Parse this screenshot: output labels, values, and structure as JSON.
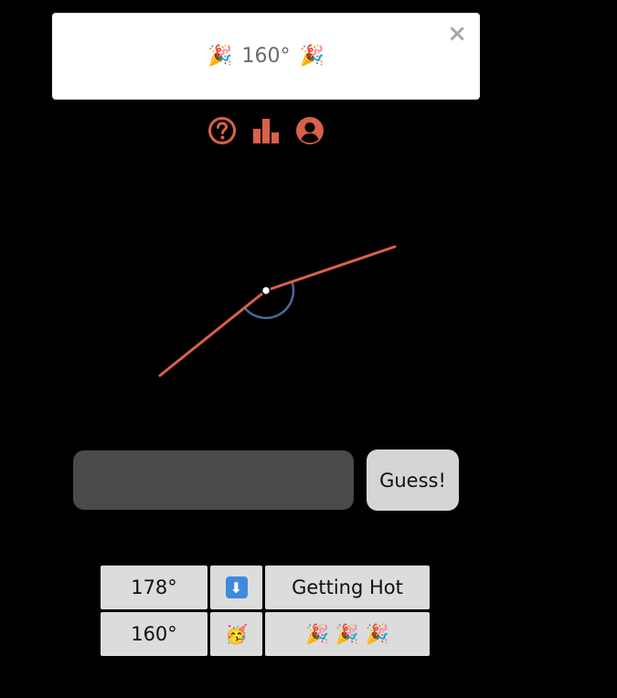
{
  "banner": {
    "result_text": "160°",
    "emoji_left": "🎉",
    "emoji_right": "🎉",
    "close_glyph": "×"
  },
  "icons": {
    "help": "question-circle-icon",
    "stats": "bar-chart-icon",
    "profile": "user-circle-icon",
    "accent_color": "#d9604a"
  },
  "angle": {
    "degrees": 160,
    "line_color": "#d9604a",
    "arc_color": "#4a6b9a"
  },
  "guess": {
    "input_value": "",
    "input_placeholder": "",
    "button_label": "Guess!"
  },
  "history": [
    {
      "guess": "178°",
      "direction": "⬇",
      "hint": "Getting Hot"
    },
    {
      "guess": "160°",
      "direction": "🥳",
      "hint": "🎉 🎉 🎉"
    }
  ]
}
